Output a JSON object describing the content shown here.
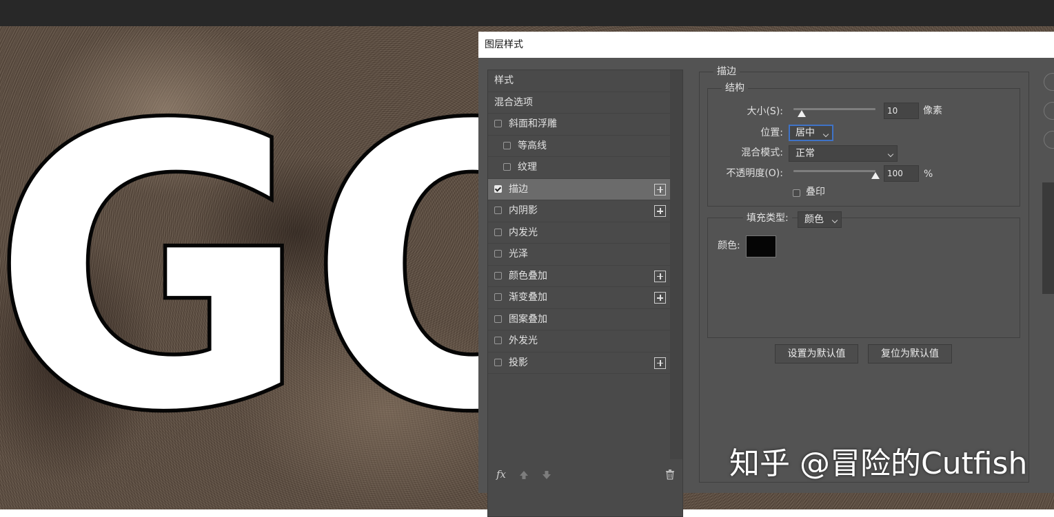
{
  "dialog": {
    "title": "图层样式"
  },
  "style_list": {
    "items": [
      {
        "label": "样式",
        "checkbox": false,
        "checked": false,
        "plus": false,
        "indent": false,
        "selected": false
      },
      {
        "label": "混合选项",
        "checkbox": false,
        "checked": false,
        "plus": false,
        "indent": false,
        "selected": false
      },
      {
        "label": "斜面和浮雕",
        "checkbox": true,
        "checked": false,
        "plus": false,
        "indent": false,
        "selected": false
      },
      {
        "label": "等高线",
        "checkbox": true,
        "checked": false,
        "plus": false,
        "indent": true,
        "selected": false
      },
      {
        "label": "纹理",
        "checkbox": true,
        "checked": false,
        "plus": false,
        "indent": true,
        "selected": false
      },
      {
        "label": "描边",
        "checkbox": true,
        "checked": true,
        "plus": true,
        "indent": false,
        "selected": true
      },
      {
        "label": "内阴影",
        "checkbox": true,
        "checked": false,
        "plus": true,
        "indent": false,
        "selected": false
      },
      {
        "label": "内发光",
        "checkbox": true,
        "checked": false,
        "plus": false,
        "indent": false,
        "selected": false
      },
      {
        "label": "光泽",
        "checkbox": true,
        "checked": false,
        "plus": false,
        "indent": false,
        "selected": false
      },
      {
        "label": "颜色叠加",
        "checkbox": true,
        "checked": false,
        "plus": true,
        "indent": false,
        "selected": false
      },
      {
        "label": "渐变叠加",
        "checkbox": true,
        "checked": false,
        "plus": true,
        "indent": false,
        "selected": false
      },
      {
        "label": "图案叠加",
        "checkbox": true,
        "checked": false,
        "plus": false,
        "indent": false,
        "selected": false
      },
      {
        "label": "外发光",
        "checkbox": true,
        "checked": false,
        "plus": false,
        "indent": false,
        "selected": false
      },
      {
        "label": "投影",
        "checkbox": true,
        "checked": false,
        "plus": true,
        "indent": false,
        "selected": false
      }
    ],
    "fx_label": "fx"
  },
  "stroke": {
    "section_title": "描边",
    "structure_title": "结构",
    "size_label": "大小(S):",
    "size_value": "10",
    "size_unit": "像素",
    "size_slider_fraction": 0.1,
    "position_label": "位置:",
    "position_value": "居中",
    "blend_label": "混合模式:",
    "blend_value": "正常",
    "opacity_label": "不透明度(O):",
    "opacity_value": "100",
    "opacity_unit": "%",
    "opacity_slider_fraction": 1.0,
    "overprint_label": "叠印",
    "fill_type_label": "填充类型:",
    "fill_type_value": "颜色",
    "color_label": "颜色:",
    "color_value": "#050505",
    "set_default_button": "设置为默认值",
    "reset_default_button": "复位为默认值"
  },
  "canvas": {
    "text": "GO"
  },
  "watermark": "知乎 @冒险的Cutfish"
}
